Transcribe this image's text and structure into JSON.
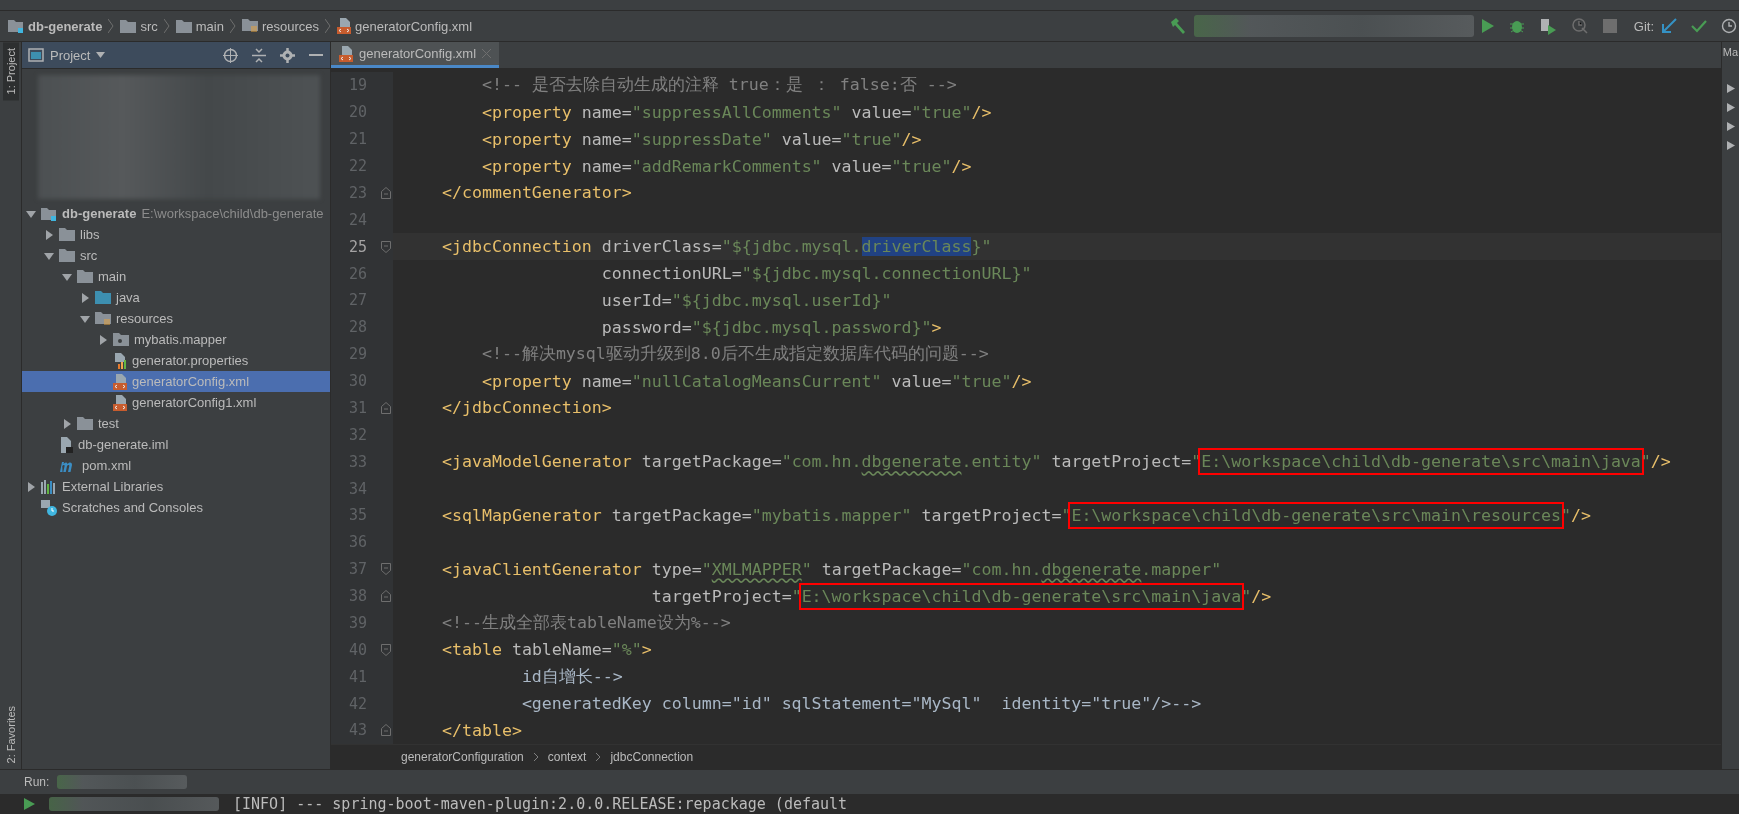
{
  "nav_bar": {
    "breadcrumbs": [
      {
        "label": "db-generate",
        "kind": "module"
      },
      {
        "label": "src",
        "kind": "folder"
      },
      {
        "label": "main",
        "kind": "folder"
      },
      {
        "label": "resources",
        "kind": "resources-folder"
      },
      {
        "label": "generatorConfig.xml",
        "kind": "xml"
      }
    ],
    "git_label": "Git:",
    "side_tab": "Ma"
  },
  "left_strip": {
    "top_tab": "1: Project",
    "bottom_tab": "2: Favorites"
  },
  "project_panel": {
    "title": "Project",
    "tree": [
      {
        "label": "db-generate",
        "kind": "module",
        "hint": "E:\\workspace\\child\\db-generate",
        "expanded": true,
        "selected": false,
        "children": [
          {
            "label": "libs",
            "kind": "folder",
            "expanded": false,
            "selected": false
          },
          {
            "label": "src",
            "kind": "folder",
            "expanded": true,
            "selected": false,
            "children": [
              {
                "label": "main",
                "kind": "folder",
                "expanded": true,
                "selected": false,
                "children": [
                  {
                    "label": "java",
                    "kind": "source-folder",
                    "expanded": false,
                    "selected": false
                  },
                  {
                    "label": "resources",
                    "kind": "resources-folder",
                    "expanded": true,
                    "selected": false,
                    "children": [
                      {
                        "label": "mybatis.mapper",
                        "kind": "package",
                        "expanded": false,
                        "selected": false
                      },
                      {
                        "label": "generator.properties",
                        "kind": "properties",
                        "selected": false
                      },
                      {
                        "label": "generatorConfig.xml",
                        "kind": "xml",
                        "selected": true
                      },
                      {
                        "label": "generatorConfig1.xml",
                        "kind": "xml",
                        "selected": false
                      }
                    ]
                  }
                ]
              },
              {
                "label": "test",
                "kind": "folder",
                "expanded": false,
                "selected": false
              }
            ]
          },
          {
            "label": "db-generate.iml",
            "kind": "iml",
            "selected": false
          },
          {
            "label": "pom.xml",
            "kind": "maven",
            "selected": false
          }
        ]
      },
      {
        "label": "External Libraries",
        "kind": "libraries",
        "expanded": false,
        "selected": false
      },
      {
        "label": "Scratches and Consoles",
        "kind": "scratches",
        "selected": false
      }
    ]
  },
  "editor": {
    "tabs": [
      {
        "label": "generatorConfig.xml",
        "selected": true
      }
    ],
    "lines": [
      {
        "number": "19",
        "current": false,
        "tokens": [
          {
            "kind": "comment",
            "text": "        <!-- 是否去除自动生成的注释 true：是 ： false:否 -->"
          }
        ]
      },
      {
        "number": "20",
        "current": false,
        "tokens": [
          {
            "kind": "tag",
            "text": "        <property"
          },
          {
            "kind": "attr",
            "text": " name="
          },
          {
            "kind": "str",
            "text": "\"suppressAllComments\""
          },
          {
            "kind": "attr",
            "text": " value="
          },
          {
            "kind": "str",
            "text": "\"true\""
          },
          {
            "kind": "tag",
            "text": "/>"
          }
        ]
      },
      {
        "number": "21",
        "current": false,
        "tokens": [
          {
            "kind": "tag",
            "text": "        <property"
          },
          {
            "kind": "attr",
            "text": " name="
          },
          {
            "kind": "str",
            "text": "\"suppressDate\""
          },
          {
            "kind": "attr",
            "text": " value="
          },
          {
            "kind": "str",
            "text": "\"true\""
          },
          {
            "kind": "tag",
            "text": "/>"
          }
        ]
      },
      {
        "number": "22",
        "current": false,
        "tokens": [
          {
            "kind": "tag",
            "text": "        <property"
          },
          {
            "kind": "attr",
            "text": " name="
          },
          {
            "kind": "str",
            "text": "\"addRemarkComments\""
          },
          {
            "kind": "attr",
            "text": " value="
          },
          {
            "kind": "str",
            "text": "\"true\""
          },
          {
            "kind": "tag",
            "text": "/>"
          }
        ]
      },
      {
        "number": "23",
        "current": false,
        "fold_close": true,
        "tokens": [
          {
            "kind": "tag",
            "text": "    </commentGenerator>"
          }
        ]
      },
      {
        "number": "24",
        "current": false
      },
      {
        "number": "25",
        "current": true,
        "fold_open": true,
        "tokens": [
          {
            "kind": "tag",
            "text": "    <jdbcConnection"
          },
          {
            "kind": "attr",
            "text": " driverClass="
          },
          {
            "kind": "str",
            "text": "\"${jdbc.mysql."
          },
          {
            "kind": "sel",
            "text": "driverClass"
          },
          {
            "kind": "str",
            "text": "}\""
          }
        ]
      },
      {
        "number": "26",
        "current": false,
        "tokens": [
          {
            "kind": "attr",
            "text": "                    connectionURL="
          },
          {
            "kind": "str",
            "text": "\"${jdbc.mysql.connectionURL}\""
          }
        ]
      },
      {
        "number": "27",
        "current": false,
        "tokens": [
          {
            "kind": "attr",
            "text": "                    userId="
          },
          {
            "kind": "str",
            "text": "\"${jdbc.mysql.userId}\""
          }
        ]
      },
      {
        "number": "28",
        "current": false,
        "tokens": [
          {
            "kind": "attr",
            "text": "                    password="
          },
          {
            "kind": "str",
            "text": "\"${jdbc.mysql.password}\""
          },
          {
            "kind": "tag",
            "text": ">"
          }
        ]
      },
      {
        "number": "29",
        "current": false,
        "tokens": [
          {
            "kind": "comment",
            "text": "        <!--解决mysql驱动升级到8.0后不生成指定数据库代码的问题-->"
          }
        ]
      },
      {
        "number": "30",
        "current": false,
        "tokens": [
          {
            "kind": "tag",
            "text": "        <property"
          },
          {
            "kind": "attr",
            "text": " name="
          },
          {
            "kind": "str",
            "text": "\"nullCatalogMeansCurrent\""
          },
          {
            "kind": "attr",
            "text": " value="
          },
          {
            "kind": "str",
            "text": "\"true\""
          },
          {
            "kind": "tag",
            "text": "/>"
          }
        ]
      },
      {
        "number": "31",
        "current": false,
        "fold_close": true,
        "tokens": [
          {
            "kind": "tag",
            "text": "    </jdbcConnection>"
          }
        ]
      },
      {
        "number": "32",
        "current": false
      },
      {
        "number": "33",
        "current": false,
        "tokens": [
          {
            "kind": "tag",
            "text": "    <javaModelGenerator"
          },
          {
            "kind": "attr",
            "text": " targetPackage="
          },
          {
            "kind": "str",
            "text": "\"com.hn."
          },
          {
            "kind": "str",
            "text": "dbgenerate",
            "typo": true
          },
          {
            "kind": "str",
            "text": ".entity\""
          },
          {
            "kind": "attr",
            "text": " targetProject="
          },
          {
            "kind": "str",
            "text": "\""
          },
          {
            "kind": "str",
            "text": "E:\\workspace\\child\\db-generate\\src\\main\\java",
            "boxed": true
          },
          {
            "kind": "str",
            "text": "\""
          },
          {
            "kind": "tag",
            "text": "/>"
          }
        ]
      },
      {
        "number": "34",
        "current": false
      },
      {
        "number": "35",
        "current": false,
        "tokens": [
          {
            "kind": "tag",
            "text": "    <sqlMapGenerator"
          },
          {
            "kind": "attr",
            "text": " targetPackage="
          },
          {
            "kind": "str",
            "text": "\"mybatis.mapper\""
          },
          {
            "kind": "attr",
            "text": " targetProject="
          },
          {
            "kind": "str",
            "text": "\""
          },
          {
            "kind": "str",
            "text": "E:\\workspace\\child\\db-generate\\src\\main\\resources",
            "boxed": true
          },
          {
            "kind": "str",
            "text": "\""
          },
          {
            "kind": "tag",
            "text": "/>"
          }
        ]
      },
      {
        "number": "36",
        "current": false
      },
      {
        "number": "37",
        "current": false,
        "fold_open": true,
        "tokens": [
          {
            "kind": "tag",
            "text": "    <javaClientGenerator"
          },
          {
            "kind": "attr",
            "text": " type="
          },
          {
            "kind": "str",
            "text": "\""
          },
          {
            "kind": "str",
            "text": "XMLMAPPER",
            "typo": true
          },
          {
            "kind": "str",
            "text": "\""
          },
          {
            "kind": "attr",
            "text": " targetPackage="
          },
          {
            "kind": "str",
            "text": "\"com.hn."
          },
          {
            "kind": "str",
            "text": "dbgenerate",
            "typo": true
          },
          {
            "kind": "str",
            "text": ".mapper\""
          }
        ]
      },
      {
        "number": "38",
        "current": false,
        "fold_close": true,
        "tokens": [
          {
            "kind": "attr",
            "text": "                         targetProject="
          },
          {
            "kind": "str",
            "text": "\""
          },
          {
            "kind": "str",
            "text": "E:\\workspace\\child\\db-generate\\src\\main\\java",
            "boxed": true
          },
          {
            "kind": "str",
            "text": "\""
          },
          {
            "kind": "tag",
            "text": "/>"
          }
        ]
      },
      {
        "number": "39",
        "current": false,
        "tokens": [
          {
            "kind": "comment",
            "text": "    <!--生成全部表tableName设为%-->"
          }
        ]
      },
      {
        "number": "40",
        "current": false,
        "fold_open": true,
        "tokens": [
          {
            "kind": "tag",
            "text": "    <table"
          },
          {
            "kind": "attr",
            "text": " tableName="
          },
          {
            "kind": "str",
            "text": "\"%\""
          },
          {
            "kind": "tag",
            "text": ">"
          }
        ]
      },
      {
        "number": "41",
        "current": false,
        "tokens": [
          {
            "kind": "text",
            "text": "            id自增长-->"
          }
        ]
      },
      {
        "number": "42",
        "current": false,
        "tokens": [
          {
            "kind": "text",
            "text": "            <generatedKey column=\"id\" sqlStatement=\"MySql\"  identity=\"true\"/>-->"
          }
        ]
      },
      {
        "number": "43",
        "current": false,
        "fold_close": true,
        "tokens": [
          {
            "kind": "tag",
            "text": "    </table>"
          }
        ]
      }
    ],
    "breadcrumbs": [
      "generatorConfiguration",
      "context",
      "jdbcConnection"
    ]
  },
  "run_panel": {
    "label": "Run:",
    "output": "[INFO] --- spring-boot-maven-plugin:2.0.0.RELEASE:repackage (default"
  }
}
